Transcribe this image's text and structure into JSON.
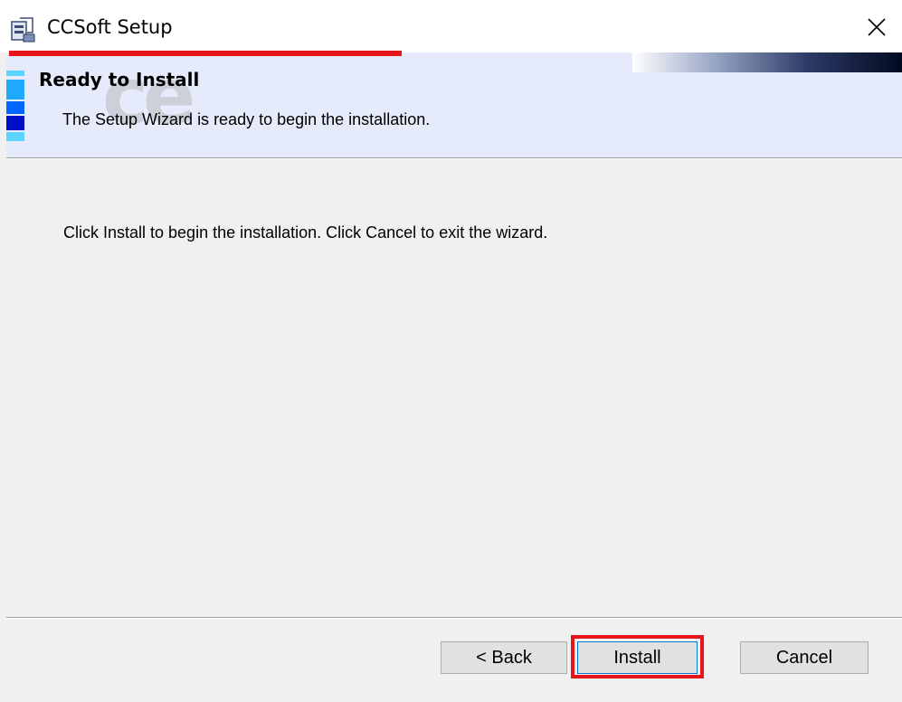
{
  "window": {
    "title": "CCSoft Setup",
    "close_glyph": "✕"
  },
  "banner": {
    "title": "Ready to Install",
    "subtitle": "The Setup Wizard is ready to begin the installation.",
    "watermark": "ce"
  },
  "body": {
    "message": "Click Install to begin the installation.  Click Cancel to exit the wizard."
  },
  "buttons": {
    "back_label": "< Back",
    "install_label": "Install",
    "cancel_label": "Cancel"
  },
  "colors": {
    "highlight": "#e8141b",
    "banner_bg": "#e6ebfb",
    "dialog_bg": "#f0f0f0"
  },
  "icons": {
    "app": "installer-package-icon",
    "close": "close-icon"
  }
}
